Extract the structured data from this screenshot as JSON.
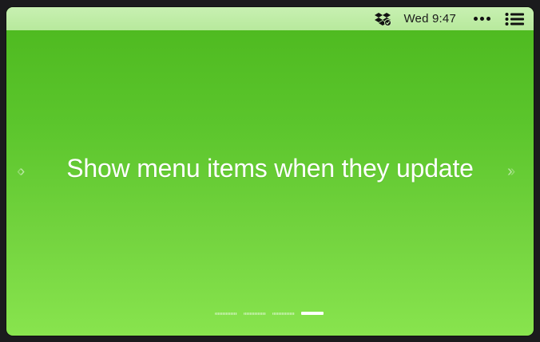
{
  "menubar": {
    "clock": "Wed 9:47",
    "icons": [
      "dropbox-icon",
      "more-dots-icon",
      "list-menu-icon"
    ]
  },
  "slide": {
    "title": "Show menu items when they update"
  },
  "pager": {
    "total": 4,
    "active_index": 3
  },
  "colors": {
    "background_top": "#4cb81e",
    "background_bottom": "#88e44e",
    "menubar": "#c8f0b2",
    "text": "#ffffff"
  }
}
